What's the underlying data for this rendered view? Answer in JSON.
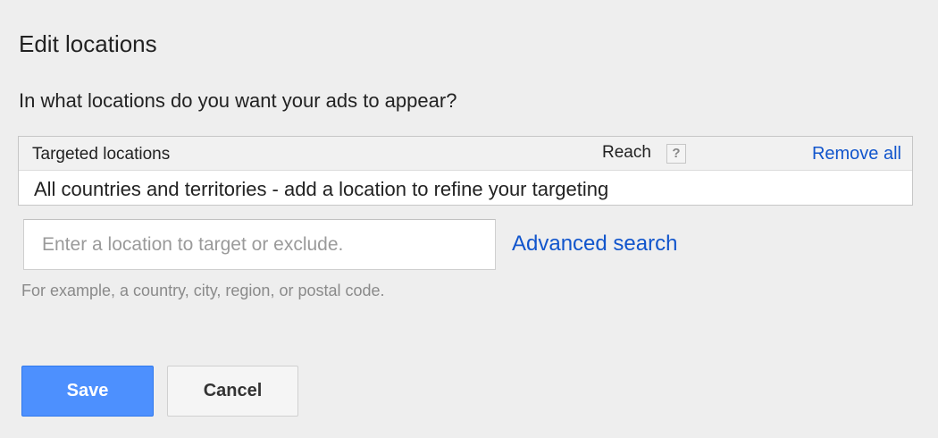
{
  "dialog": {
    "title": "Edit locations",
    "question": "In what locations do you want your ads to appear?"
  },
  "table": {
    "headers": {
      "targeted_locations": "Targeted locations",
      "reach": "Reach",
      "help_glyph": "?",
      "remove_all": "Remove all"
    },
    "rows": [
      "All countries and territories - add a location to refine your targeting"
    ]
  },
  "search": {
    "value": "",
    "placeholder": "Enter a location to target or exclude.",
    "advanced_link": "Advanced search",
    "hint": "For example, a country, city, region, or postal code."
  },
  "actions": {
    "save_label": "Save",
    "cancel_label": "Cancel"
  },
  "colors": {
    "background": "#eeeeee",
    "link": "#1155cc",
    "primary_button": "#4d90fe",
    "secondary_button": "#f5f5f5"
  },
  "icons": {
    "reach_help": "help-icon"
  }
}
